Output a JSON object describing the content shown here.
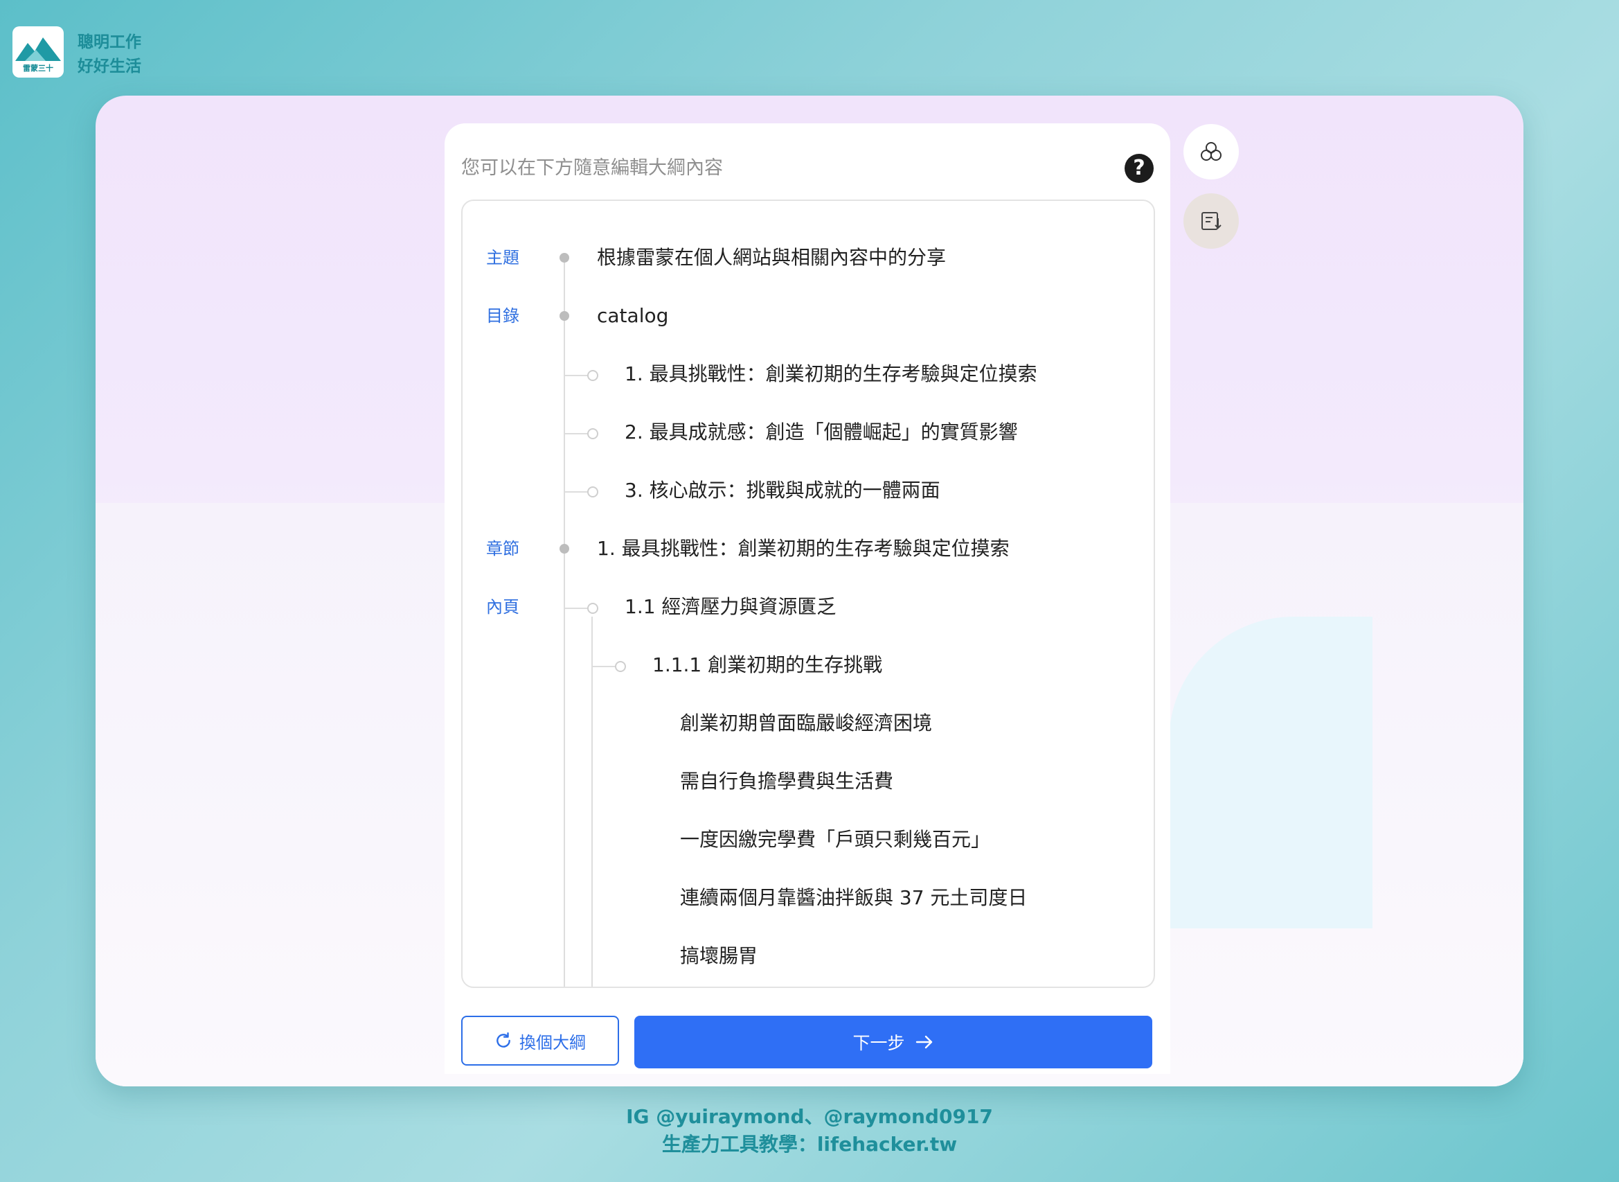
{
  "brand": {
    "logo_caption": "雷蒙三十",
    "line1": "聰明工作",
    "line2": "好好生活"
  },
  "panel": {
    "title": "您可以在下方隨意編輯大綱內容",
    "help_label": "?"
  },
  "labels": {
    "topic": "主題",
    "catalog": "目錄",
    "chapter": "章節",
    "page": "內頁"
  },
  "outline": {
    "topic": "根據雷蒙在個人網站與相關內容中的分享",
    "catalog_title": "catalog",
    "catalog_items": [
      "1. 最具挑戰性：創業初期的生存考驗與定位摸索",
      "2. 最具成就感：創造「個體崛起」的實質影響",
      "3. 核心啟示：挑戰與成就的一體兩面"
    ],
    "chapter": "1. 最具挑戰性：創業初期的生存考驗與定位摸索",
    "section": "1.1 經濟壓力與資源匱乏",
    "subsection": "1.1.1 創業初期的生存挑戰",
    "points": [
      "創業初期曾面臨嚴峻經濟困境",
      "需自行負擔學費與生活費",
      "一度因繳完學費「戶頭只剩幾百元」",
      "連續兩個月靠醬油拌飯與 37 元土司度日",
      "搞壞腸胃"
    ]
  },
  "actions": {
    "regenerate_label": "換個大綱",
    "next_label": "下一步"
  },
  "icons": {
    "help": "question-circle-icon",
    "refresh": "refresh-icon",
    "arrow": "arrow-right-icon",
    "side_one": "three-circles-icon",
    "side_two": "list-download-icon"
  },
  "footer": {
    "line1": "IG @yuiraymond、@raymond0917",
    "line2": "生產力工具教學：lifehacker.tw"
  },
  "colors": {
    "accent": "#2f6ff5",
    "tag_blue": "#2f6fe0",
    "brand_teal": "#1d8d99"
  }
}
